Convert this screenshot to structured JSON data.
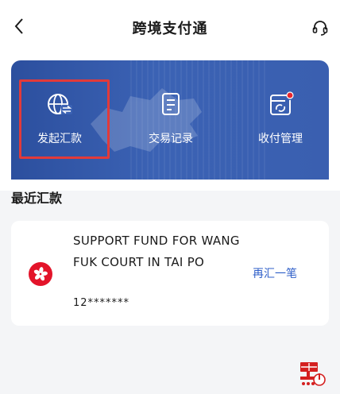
{
  "header": {
    "title": "跨境支付通",
    "back_icon": "chevron-left-icon",
    "support_icon": "headset-icon"
  },
  "banner": {
    "actions": [
      {
        "label": "发起汇款",
        "icon": "globe-transfer-icon"
      },
      {
        "label": "交易记录",
        "icon": "document-list-icon"
      },
      {
        "label": "收付管理",
        "icon": "card-manage-icon"
      }
    ],
    "highlighted_action": "发起汇款",
    "colors": {
      "primary": "#3a5fb0",
      "highlight": "#e23a3a",
      "badge": "#e8262d"
    }
  },
  "recent": {
    "title": "最近汇款",
    "items": [
      {
        "payee_name": "SUPPORT FUND FOR WANG FUK COURT IN TAI PO",
        "account": "12*******",
        "action_label": "再汇一笔",
        "flag_icon": "hong-kong-flag-icon"
      }
    ]
  },
  "floating": {
    "icon": "hei-floating-icon"
  }
}
